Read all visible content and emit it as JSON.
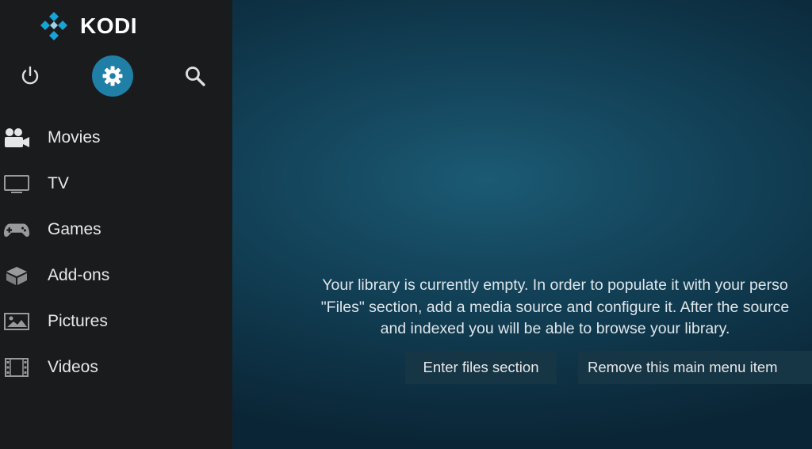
{
  "app": {
    "name": "KODI"
  },
  "top_buttons": [
    "power",
    "settings",
    "search"
  ],
  "menu": [
    {
      "label": "Movies",
      "icon": "movie-camera-icon"
    },
    {
      "label": "TV",
      "icon": "tv-icon"
    },
    {
      "label": "Games",
      "icon": "gamepad-icon"
    },
    {
      "label": "Add-ons",
      "icon": "addons-box-icon"
    },
    {
      "label": "Pictures",
      "icon": "picture-icon"
    },
    {
      "label": "Videos",
      "icon": "film-strip-icon"
    }
  ],
  "content": {
    "message_lines": [
      "Your library is currently empty. In order to populate it with your perso",
      "\"Files\" section, add a media source and configure it. After the source",
      "and indexed you will be able to browse your library."
    ],
    "enter_files_label": "Enter files section",
    "remove_item_label": "Remove this main menu item"
  },
  "colors": {
    "sidebar_bg": "#1a1b1d",
    "accent": "#1f7fa7",
    "logo_blue": "#17a3d6",
    "content_bg": "#14465d"
  }
}
